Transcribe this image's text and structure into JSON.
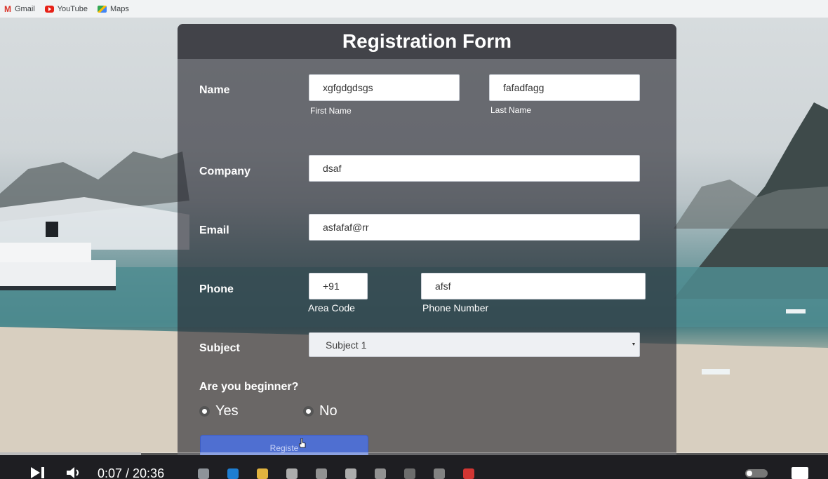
{
  "bookmarks": [
    {
      "label": "Gmail",
      "icon": "gmail-icon"
    },
    {
      "label": "YouTube",
      "icon": "youtube-icon"
    },
    {
      "label": "Maps",
      "icon": "maps-icon"
    }
  ],
  "form": {
    "title": "Registration Form",
    "name": {
      "label": "Name",
      "first_value": "xgfgdgdsgs",
      "first_caption": "First Name",
      "last_value": "fafadfagg",
      "last_caption": "Last Name"
    },
    "company": {
      "label": "Company",
      "value": "dsaf"
    },
    "email": {
      "label": "Email",
      "value": "asfafaf@rr"
    },
    "phone": {
      "label": "Phone",
      "area_value": "+91",
      "area_caption": "Area Code",
      "number_value": "afsf",
      "number_caption": "Phone Number"
    },
    "subject": {
      "label": "Subject",
      "selected": "Subject 1"
    },
    "beginner": {
      "question": "Are you beginner?",
      "yes": "Yes",
      "no": "No"
    },
    "register_label": "Registe"
  },
  "video": {
    "time": "0:07 / 20:36",
    "progress_fraction": 0.17
  },
  "colors": {
    "panel": "#26262e",
    "button": "#4f6fd1"
  }
}
